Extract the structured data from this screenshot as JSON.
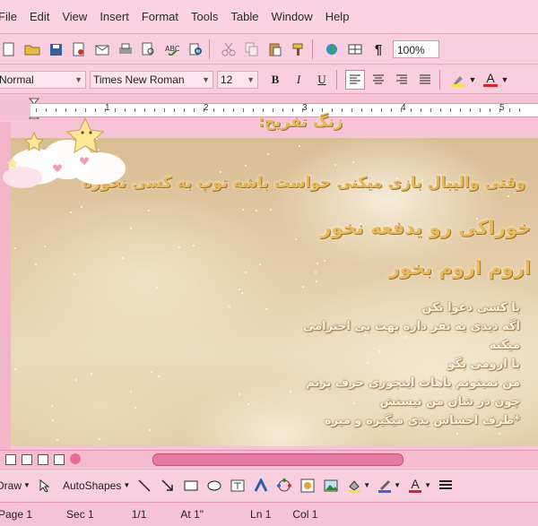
{
  "menu": [
    "File",
    "Edit",
    "View",
    "Insert",
    "Format",
    "Tools",
    "Table",
    "Window",
    "Help"
  ],
  "standard_toolbar": {
    "icons": [
      "new-document-icon",
      "open-folder-icon",
      "save-icon",
      "permission-icon",
      "email-icon",
      "print-icon",
      "print-preview-icon",
      "spelling-icon",
      "research-icon",
      "cut-icon",
      "copy-icon",
      "paste-icon",
      "format-painter-icon",
      "hyperlink-icon",
      "tables-borders-icon",
      "paragraph-marks-icon"
    ],
    "zoom": "100%"
  },
  "formatting_toolbar": {
    "style": "Normal",
    "font": "Times New Roman",
    "size": "12",
    "bold": "B",
    "italic": "I",
    "underline": "U",
    "align_icons": [
      "align-left-icon",
      "align-center-icon",
      "align-right-icon",
      "justify-icon"
    ],
    "font_color_letter": "A"
  },
  "ruler": {
    "numbers": [
      "1",
      "2",
      "3",
      "4",
      "5"
    ]
  },
  "document": {
    "lines": [
      {
        "text": "زنگ تفریح:",
        "style": "gold"
      },
      {
        "text": "وقتی والیبال بازی میکنی حواست باشه توپ به کسی نخوره",
        "style": "gold"
      },
      {
        "text": "خوراکی رو یدفعه نخور",
        "style": "gold"
      },
      {
        "text": "اروم اروم بخور",
        "style": "gold"
      },
      {
        "text": "با کسی دعوا نکن",
        "style": "pale"
      },
      {
        "text": "اگه دیدی یه نفر داره بهت بی احترامی",
        "style": "pale"
      },
      {
        "text": "میکنه",
        "style": "pale"
      },
      {
        "text": "با ارومی بگو",
        "style": "pale"
      },
      {
        "text": "من نمیتونم باهات اینجوری حرف بزنم",
        "style": "pale"
      },
      {
        "text": "چون در شان من نیستش",
        "style": "pale"
      },
      {
        "text": "*طرف احساس بدی میگیره و میره",
        "style": "pale"
      }
    ],
    "colors": {
      "gold": "#e8b85c",
      "pale": "#fff1dd",
      "sky": "#e3cca7"
    }
  },
  "drawing_toolbar": {
    "draw": "Draw",
    "autoshapes": "AutoShapes",
    "icons": [
      "select-arrow-icon",
      "line-icon",
      "arrow-icon",
      "rectangle-icon",
      "oval-icon",
      "text-box-icon",
      "wordart-icon",
      "diagram-icon",
      "clip-art-icon",
      "picture-icon",
      "fill-color-icon",
      "line-color-icon",
      "font-color-icon",
      "line-style-icon"
    ]
  },
  "status": {
    "page": "Page 1",
    "sec": "Sec 1",
    "pages": "1/1",
    "at": "At 1\"",
    "ln": "Ln 1",
    "col": "Col 1"
  },
  "theme": {
    "pink": "#f8cfdf",
    "dark_pink": "#e6a9c0"
  }
}
